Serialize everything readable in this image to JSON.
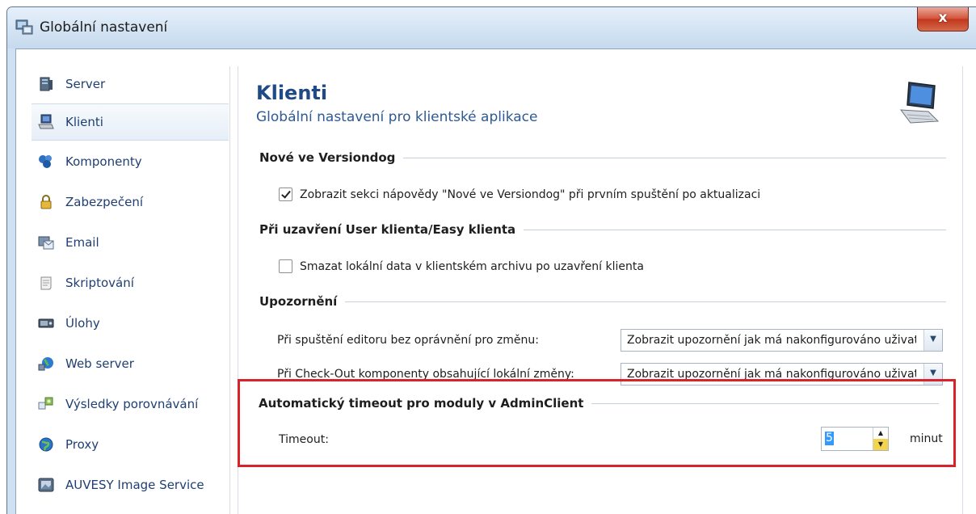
{
  "window": {
    "title": "Globální nastavení",
    "close_label": "x"
  },
  "sidebar": {
    "items": [
      {
        "label": "Server",
        "icon": "server-icon",
        "selected": false
      },
      {
        "label": "Klienti",
        "icon": "computer-icon",
        "selected": true
      },
      {
        "label": "Komponenty",
        "icon": "components-icon",
        "selected": false
      },
      {
        "label": "Zabezpečení",
        "icon": "lock-icon",
        "selected": false
      },
      {
        "label": "Email",
        "icon": "email-icon",
        "selected": false
      },
      {
        "label": "Skriptování",
        "icon": "script-icon",
        "selected": false
      },
      {
        "label": "Úlohy",
        "icon": "tasks-icon",
        "selected": false
      },
      {
        "label": "Web server",
        "icon": "globe-network-icon",
        "selected": false
      },
      {
        "label": "Výsledky porovnávání",
        "icon": "compare-icon",
        "selected": false
      },
      {
        "label": "Proxy",
        "icon": "globe-icon",
        "selected": false
      },
      {
        "label": "AUVESY Image Service",
        "icon": "image-service-icon",
        "selected": false
      }
    ]
  },
  "content": {
    "title": "Klienti",
    "subtitle": "Globální nastavení pro klientské aplikace",
    "sections": {
      "news": {
        "header": "Nové ve Versiondog",
        "checkbox_label": "Zobrazit sekci nápovědy \"Nové ve Versiondog\" při prvním spuštění po aktualizaci",
        "checked": true
      },
      "close": {
        "header": "Při uzavření User klienta/Easy klienta",
        "checkbox_label": "Smazat lokální data v klientském archivu po uzavření klienta",
        "checked": false
      },
      "warnings": {
        "header": "Upozornění",
        "row1_label": "Při spuštění editoru bez oprávnění pro změnu:",
        "row1_value": "Zobrazit upozornění jak má nakonfigurováno uživatel",
        "row2_label": "Při Check-Out komponenty obsahující lokální změny:",
        "row2_value": "Zobrazit upozornění jak má nakonfigurováno uživatel"
      },
      "timeout": {
        "header": "Automatický timeout pro moduly v AdminClient",
        "label": "Timeout:",
        "value": "5",
        "unit": "minut"
      }
    }
  },
  "colors": {
    "highlight_border": "#d9232a",
    "title_color": "#1f4a86",
    "close_button": "#c2371c"
  }
}
